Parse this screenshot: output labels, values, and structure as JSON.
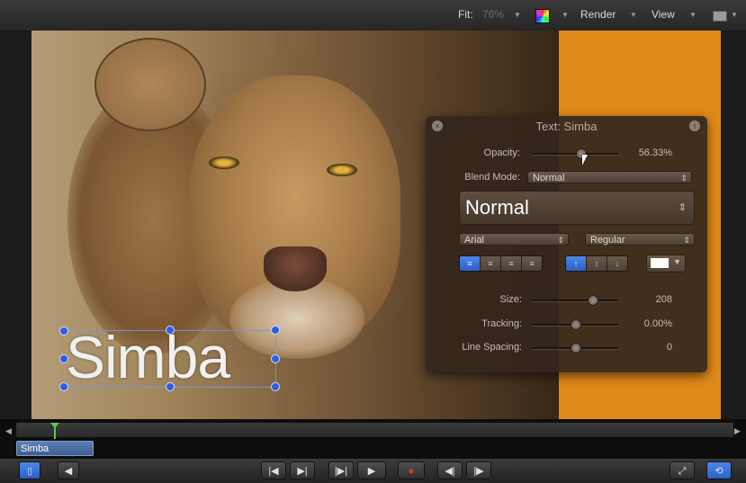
{
  "toolbar": {
    "fit_label": "Fit:",
    "fit_value": "76%",
    "render_label": "Render",
    "view_label": "View"
  },
  "canvas": {
    "title_text": "Simba",
    "accent_bg": "#e08a1a"
  },
  "inspector": {
    "title": "Text: Simba",
    "opacity_label": "Opacity:",
    "opacity_value": "56.33%",
    "opacity_level": 0.56,
    "blend_mode_label": "Blend Mode:",
    "blend_mode_value": "Normal",
    "style_preset": "Normal",
    "font_family": "Arial",
    "font_weight": "Regular",
    "size_label": "Size:",
    "size_value": "208",
    "tracking_label": "Tracking:",
    "tracking_value": "0.00%",
    "line_spacing_label": "Line Spacing:",
    "line_spacing_value": "0",
    "text_color": "#ffffff",
    "alignment_icons": [
      "align-left-icon",
      "align-center-icon",
      "align-right-icon",
      "justify-icon"
    ],
    "vertical_icons": [
      "align-top-icon",
      "align-middle-icon",
      "align-bottom-icon"
    ]
  },
  "timeline": {
    "clip_name": "Simba"
  },
  "colors": {
    "selection": "#2f5ee0",
    "playhead": "#56c856",
    "clip": "#5b7fb3"
  }
}
